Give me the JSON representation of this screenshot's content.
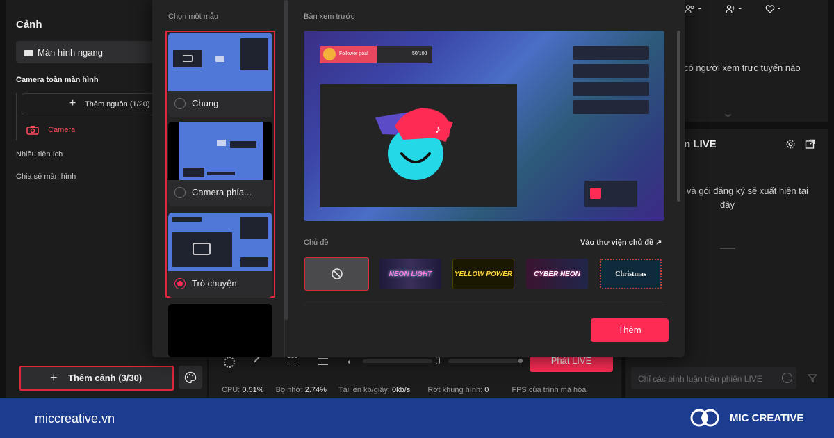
{
  "left_panel": {
    "title": "Cảnh",
    "scene_select": "Màn hình ngang",
    "group_camera": "Camera toàn màn hình",
    "add_source": "Thêm nguồn (1/20)",
    "camera_item": "Camera",
    "group_widgets": "Nhiều tiện ích",
    "group_screen": "Chia sẻ màn hình",
    "add_scene": "Thêm cảnh (3/30)"
  },
  "right_panel": {
    "stats": [
      "-",
      "-",
      "-"
    ],
    "viewers_text": "có người xem trực tuyến nào",
    "live_title": "n LIVE",
    "gift_text_1": "và gói đăng ký sẽ xuất hiện tại",
    "gift_text_2": "đây",
    "comment_placeholder": "Chỉ các bình luận trên phiên LIVE"
  },
  "bottom_bar": {
    "go_live": "Phát LIVE",
    "cpu_label": "CPU:",
    "cpu_value": "0.51%",
    "mem_label": "Bộ nhớ:",
    "mem_value": "2.74%",
    "upload_label": "Tải lên kb/giây:",
    "upload_value": "0kb/s",
    "drop_label": "Rớt khung hình:",
    "drop_value": "0",
    "fps_label": "FPS của trình mã hóa"
  },
  "modal": {
    "choose_label": "Chọn một mẫu",
    "templates": [
      {
        "label": "Chung",
        "selected": false
      },
      {
        "label": "Camera phía...",
        "selected": false
      },
      {
        "label": "Trò chuyện",
        "selected": true
      }
    ],
    "preview_label": "Bản xem trước",
    "follower_goal": "Follower goal",
    "follower_count": "50/100",
    "theme_label": "Chủ đề",
    "theme_library": "Vào thư viện chủ đề",
    "themes": [
      "NEON LIGHT",
      "YELLOW POWER",
      "CYBER NEON",
      "Christmas"
    ],
    "add_button": "Thêm"
  },
  "footer": {
    "site": "miccreative.vn",
    "brand": "MIC CREATIVE"
  },
  "colors": {
    "accent": "#fe2c55",
    "highlight_border": "#e0263a",
    "footer_bg": "#1c3d8f"
  }
}
